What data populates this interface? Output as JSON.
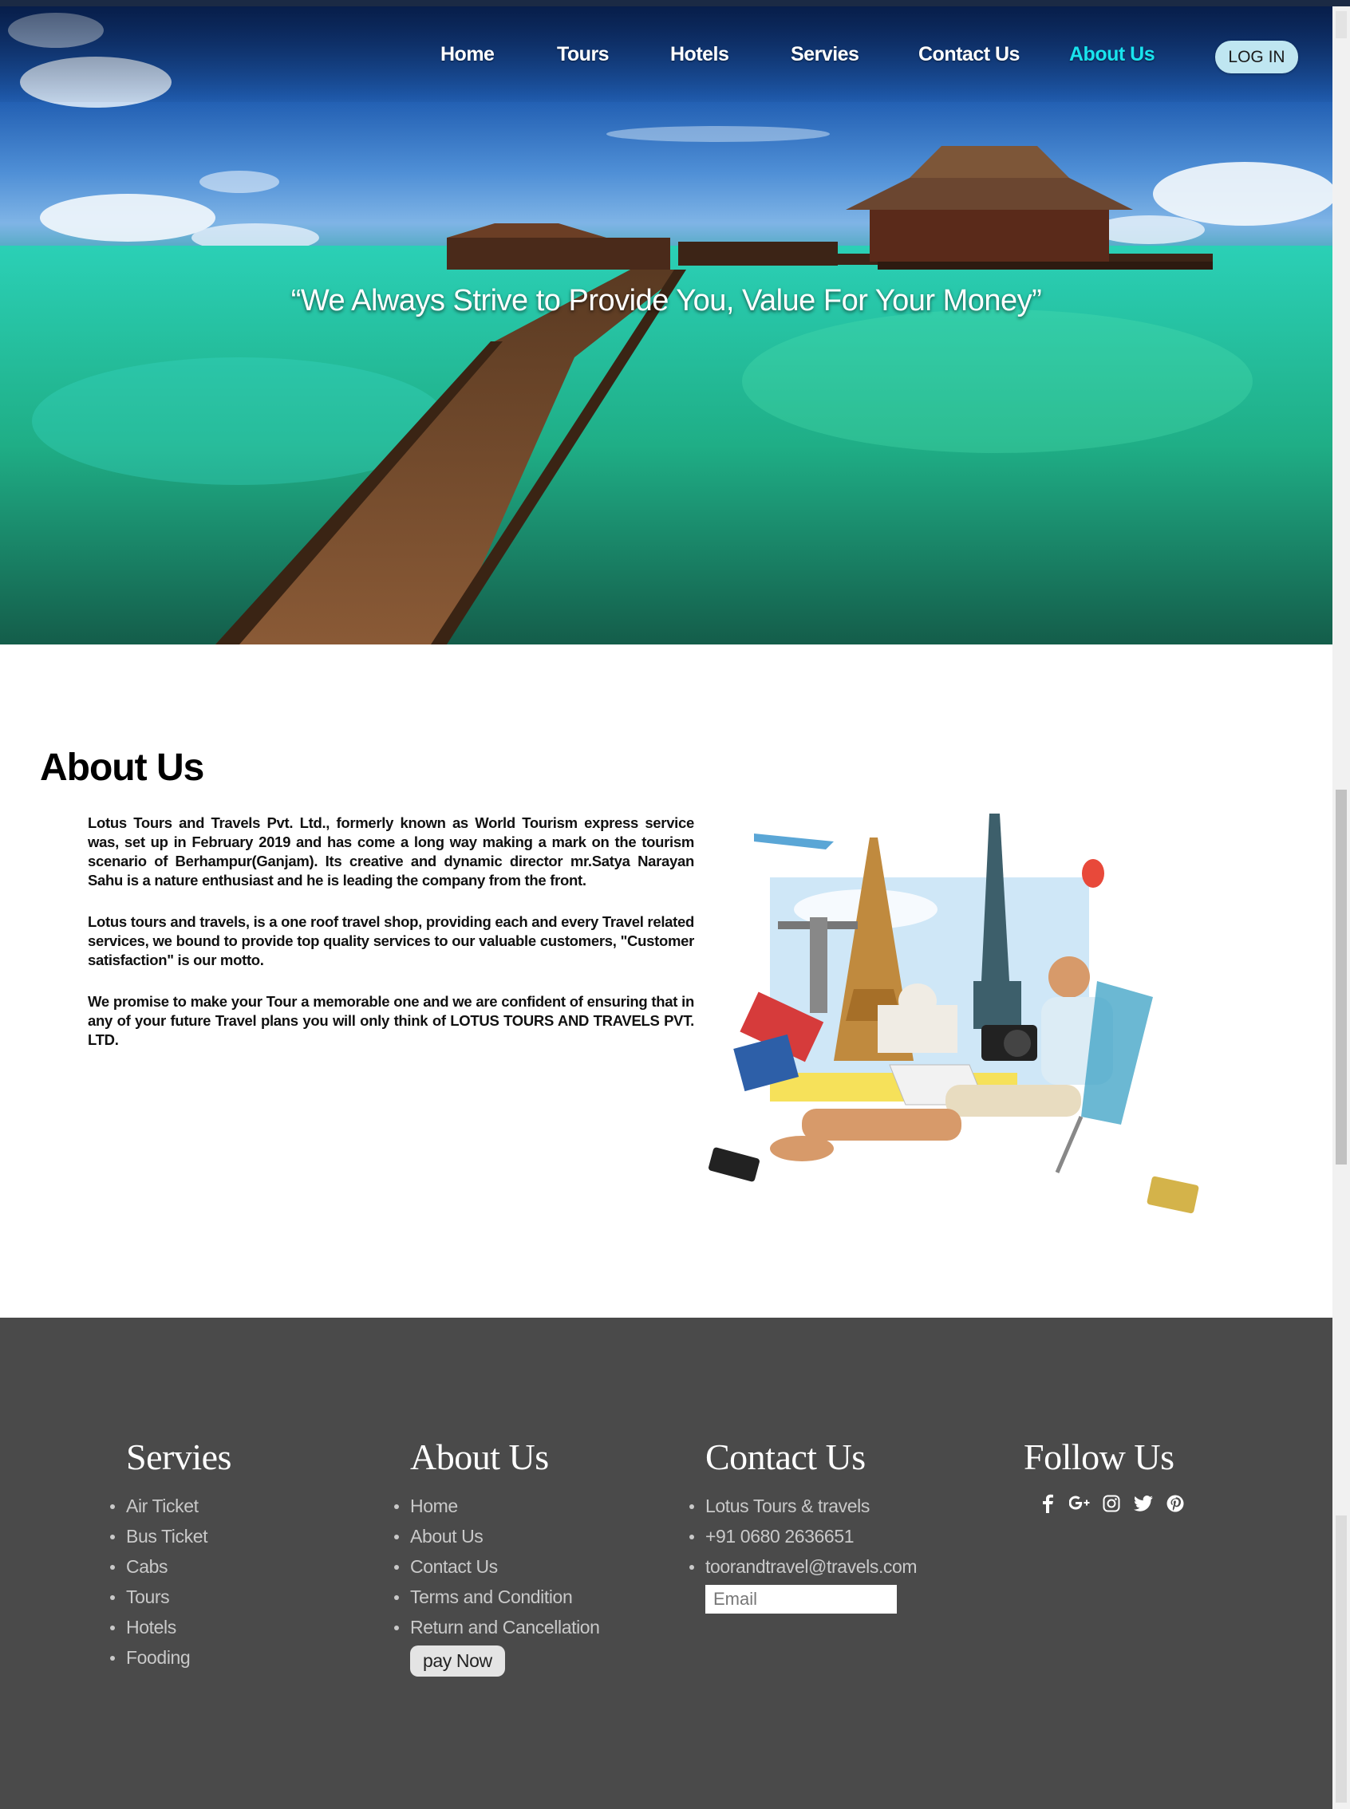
{
  "nav": {
    "items": [
      {
        "label": "Home",
        "active": false
      },
      {
        "label": "Tours",
        "active": false
      },
      {
        "label": "Hotels",
        "active": false
      },
      {
        "label": "Servies",
        "active": false
      },
      {
        "label": "Contact Us",
        "active": false
      },
      {
        "label": "About Us",
        "active": true
      }
    ],
    "login_label": "LOG IN",
    "active_color": "#19e3ee"
  },
  "hero": {
    "tagline": "“We Always Strive to Provide You, Value For Your Money”"
  },
  "about": {
    "title": "About Us",
    "paragraphs": [
      "Lotus Tours and Travels Pvt. Ltd., formerly known as World Tourism express service was, set up in February 2019 and has come a long way making a mark on the tourism scenario of Berhampur(Ganjam). Its creative and dynamic director mr.Satya Narayan Sahu is a nature enthusiast and he is leading the company from the front.",
      "Lotus tours and travels, is a one roof travel shop, providing each and every Travel related services, we bound to provide top quality services to our valuable customers, \"Customer satisfaction\" is our motto.",
      "We promise to make your Tour a memorable one and we are confident of ensuring that in any of your future Travel plans you will only think of LOTUS TOURS AND TRAVELS PVT. LTD."
    ]
  },
  "footer": {
    "background": "#4a4a4a",
    "services": {
      "title": "Servies",
      "items": [
        "Air Ticket",
        "Bus Ticket",
        "Cabs",
        "Tours",
        "Hotels",
        "Fooding"
      ]
    },
    "about": {
      "title": "About Us",
      "items": [
        "Home",
        "About Us",
        "Contact Us",
        "Terms and Condition",
        "Return and Cancellation"
      ],
      "pay_label": "pay Now"
    },
    "contact": {
      "title": "Contact Us",
      "items": [
        "Lotus Tours & travels",
        "+91 0680 2636651",
        "toorandtravel@travels.com"
      ],
      "email_placeholder": "Email"
    },
    "follow": {
      "title": "Follow Us",
      "icons": [
        "facebook-icon",
        "google-plus-icon",
        "instagram-icon",
        "twitter-icon",
        "pinterest-icon"
      ]
    }
  }
}
